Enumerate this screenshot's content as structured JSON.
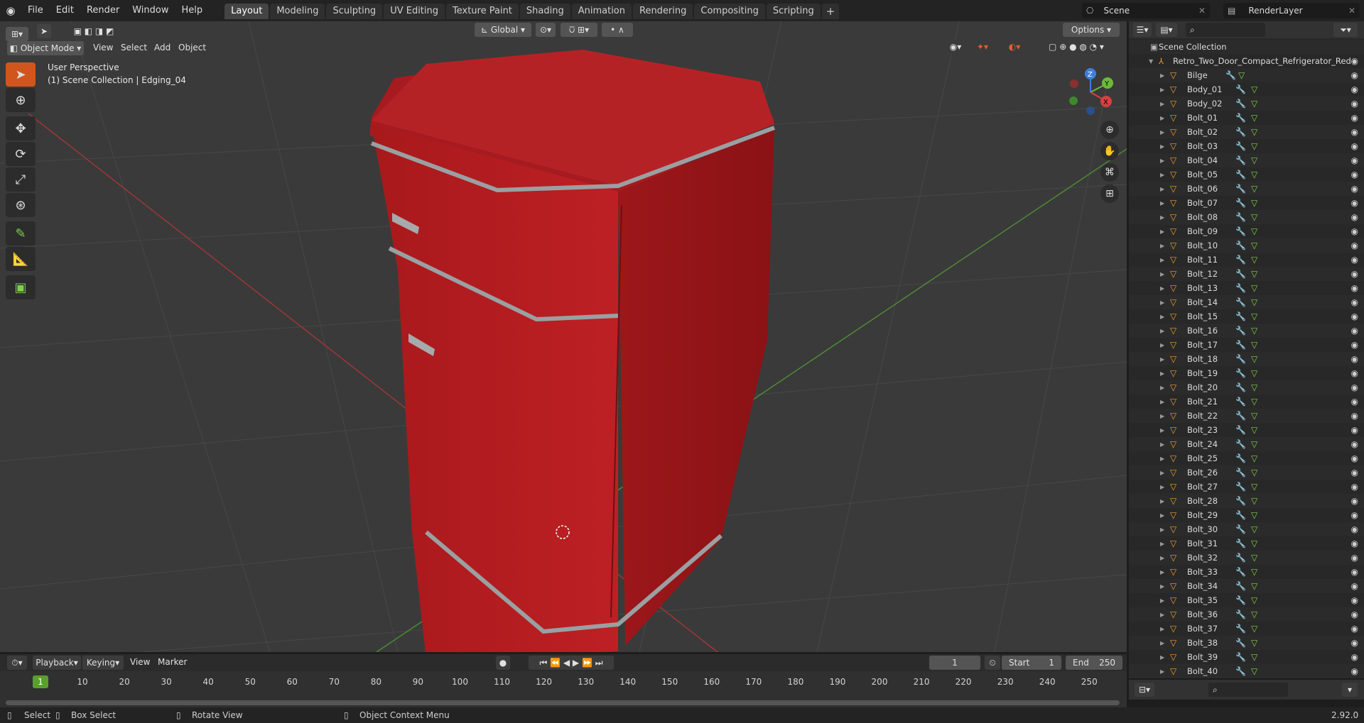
{
  "menu": [
    "File",
    "Edit",
    "Render",
    "Window",
    "Help"
  ],
  "workspaces": [
    "Layout",
    "Modeling",
    "Sculpting",
    "UV Editing",
    "Texture Paint",
    "Shading",
    "Animation",
    "Rendering",
    "Compositing",
    "Scripting"
  ],
  "add_tab": "+",
  "scene": {
    "name": "Scene",
    "layer": "RenderLayer"
  },
  "viewport": {
    "mode": "Object Mode",
    "menus": [
      "View",
      "Select",
      "Add",
      "Object"
    ],
    "orientation": "Global",
    "options": "Options",
    "overlay_line1": "User Perspective",
    "overlay_line2": "(1) Scene Collection | Edging_04"
  },
  "gizmo": {
    "z": "Z",
    "y": "Y",
    "x": "X"
  },
  "outliner": {
    "root": "Scene Collection",
    "collection": "Retro_Two_Door_Compact_Refrigerator_Red",
    "items": [
      "Bilge",
      "Body_01",
      "Body_02",
      "Bolt_01",
      "Bolt_02",
      "Bolt_03",
      "Bolt_04",
      "Bolt_05",
      "Bolt_06",
      "Bolt_07",
      "Bolt_08",
      "Bolt_09",
      "Bolt_10",
      "Bolt_11",
      "Bolt_12",
      "Bolt_13",
      "Bolt_14",
      "Bolt_15",
      "Bolt_16",
      "Bolt_17",
      "Bolt_18",
      "Bolt_19",
      "Bolt_20",
      "Bolt_21",
      "Bolt_22",
      "Bolt_23",
      "Bolt_24",
      "Bolt_25",
      "Bolt_26",
      "Bolt_27",
      "Bolt_28",
      "Bolt_29",
      "Bolt_30",
      "Bolt_31",
      "Bolt_32",
      "Bolt_33",
      "Bolt_34",
      "Bolt_35",
      "Bolt_36",
      "Bolt_37",
      "Bolt_38",
      "Bolt_39",
      "Bolt_40"
    ]
  },
  "timeline": {
    "menus": [
      "Playback",
      "Keying",
      "View",
      "Marker"
    ],
    "current_frame": "1",
    "start_label": "Start",
    "start": "1",
    "end_label": "End",
    "end": "250",
    "marker": "1",
    "ticks": [
      "10",
      "20",
      "30",
      "40",
      "50",
      "60",
      "70",
      "80",
      "90",
      "100",
      "110",
      "120",
      "130",
      "140",
      "150",
      "160",
      "170",
      "180",
      "190",
      "200",
      "210",
      "220",
      "230",
      "240",
      "250"
    ]
  },
  "status": {
    "select": "Select",
    "box_select": "Box Select",
    "rotate": "Rotate View",
    "context": "Object Context Menu",
    "version": "2.92.0"
  },
  "colors": {
    "accent": "#4772b3",
    "fridge": "#b01c20",
    "frame_marker": "#5aa02c"
  }
}
